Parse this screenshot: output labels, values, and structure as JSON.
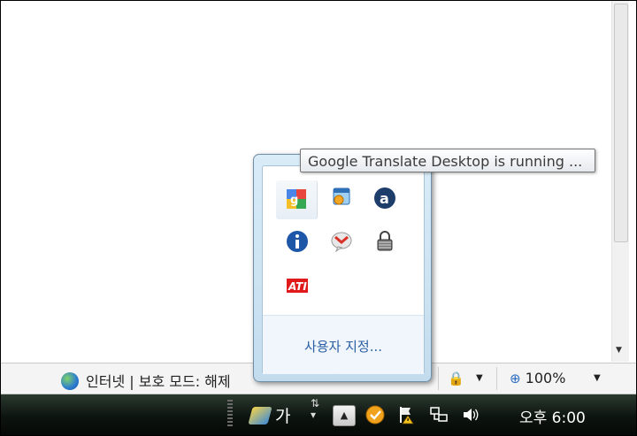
{
  "tooltip": {
    "text": "Google Translate Desktop is running ..."
  },
  "popup": {
    "customize_label": "사용자 지정...",
    "icons": [
      "google-translate-icon",
      "outlook-calendar-icon",
      "amazon-icon",
      "info-icon",
      "gmail-notifier-icon",
      "padlock-icon",
      "ati-icon"
    ]
  },
  "status_bar": {
    "zone_text": "인터넷 | 보호 모드: 해제",
    "zoom_label": "100%"
  },
  "taskbar": {
    "ime_char": "가",
    "show_hidden_glyph": "▲",
    "clock": "오후 6:00"
  }
}
